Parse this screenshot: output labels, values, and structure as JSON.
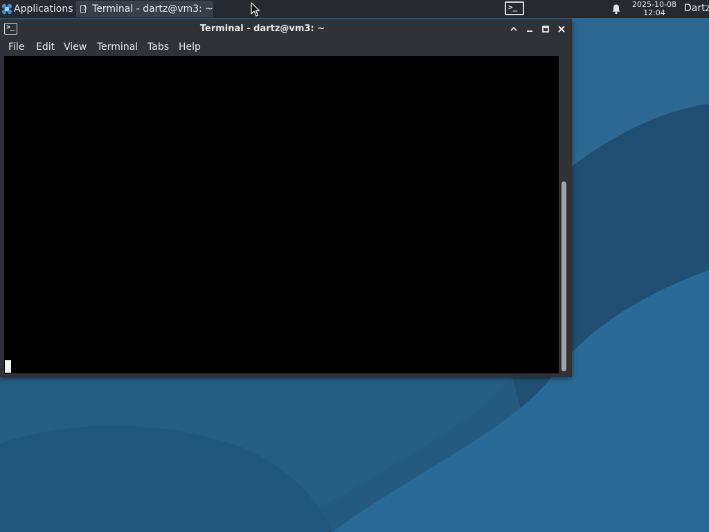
{
  "panel": {
    "applications_label": "Applications",
    "applications_separator": "≡",
    "task_label": "Terminal - dartz@vm3: ~",
    "tray_prompt": ">_",
    "clock_date": "2025-10-08",
    "clock_time": "12:04",
    "user_label": "Dartz"
  },
  "window": {
    "title": "Terminal - dartz@vm3: ~",
    "icon_prompt": ">_",
    "menu": [
      "File",
      "Edit",
      "View",
      "Terminal",
      "Tabs",
      "Help"
    ]
  },
  "icons": {
    "applications": "xfce-logo-icon",
    "task": "terminal-icon",
    "tray": "terminal-icon",
    "notifications": "bell-icon",
    "window_shade": "chevron-up-icon",
    "minimize": "minimize-icon",
    "maximize": "maximize-icon",
    "close": "close-icon",
    "pointer": "mouse-pointer-icon"
  },
  "colors": {
    "panel_bg": "#262a2f",
    "window_bg": "#2f3237",
    "terminal_bg": "#000000",
    "desktop_bg": "#245a80"
  }
}
